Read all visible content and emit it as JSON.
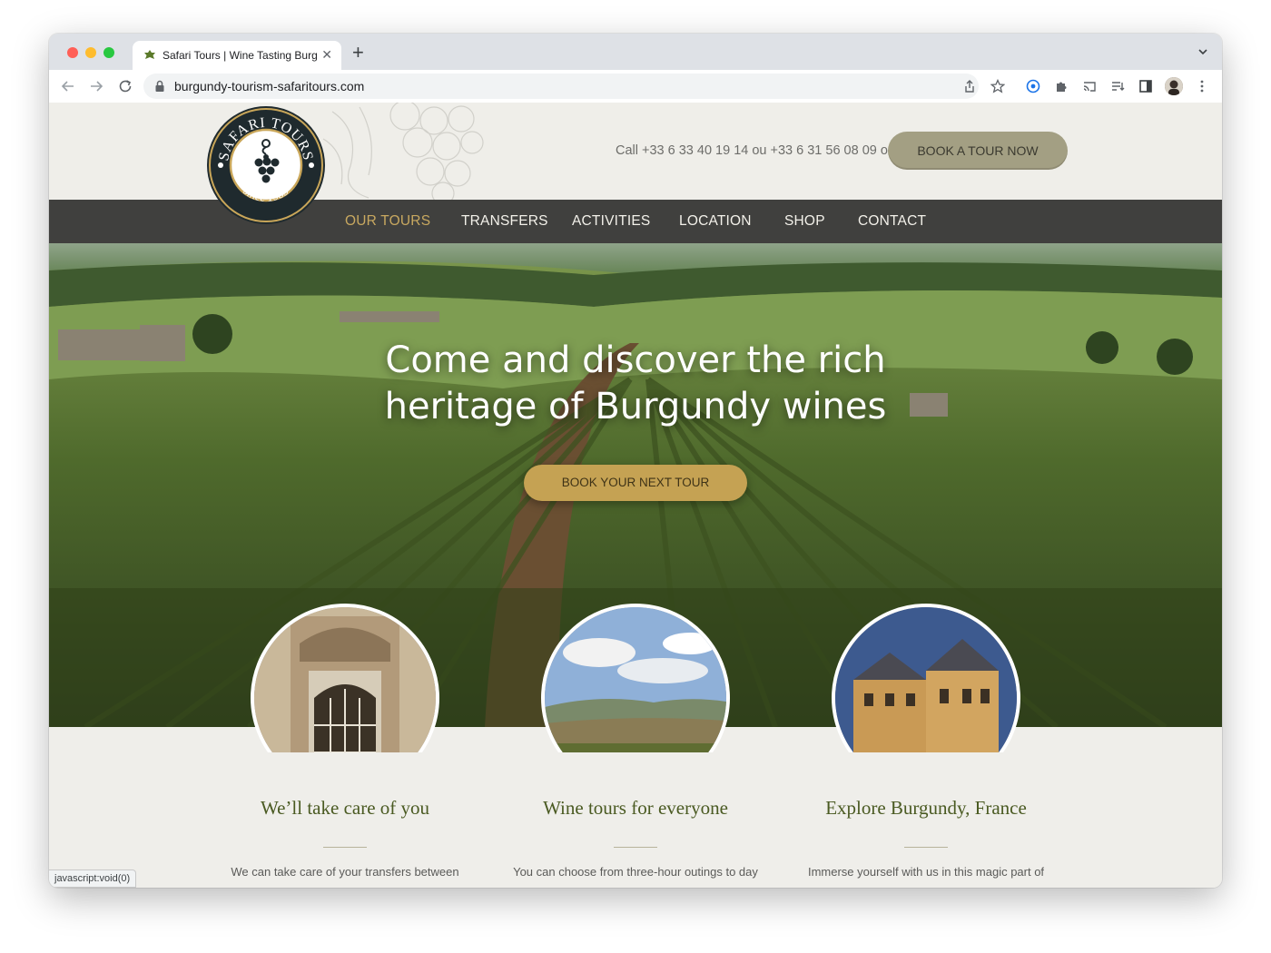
{
  "browser": {
    "tab_title": "Safari Tours | Wine Tasting Burg",
    "new_tab": "+",
    "tab_close": "✕",
    "url": "burgundy-tourism-safaritours.com",
    "status_text": "javascript:void(0)"
  },
  "header": {
    "call_text": "Call +33 6 33 40 19 14 ou +33 6 31 56 08 09 or",
    "book_now": "BOOK A TOUR NOW",
    "logo_top": "SAFARI TOURS",
    "logo_bottom": "since 1985"
  },
  "nav": {
    "items": [
      {
        "label": "OUR TOURS",
        "active": true
      },
      {
        "label": "TRANSFERS",
        "active": false
      },
      {
        "label": "ACTIVITIES",
        "active": false
      },
      {
        "label": "LOCATION",
        "active": false
      },
      {
        "label": "SHOP",
        "active": false
      },
      {
        "label": "CONTACT",
        "active": false
      }
    ]
  },
  "hero": {
    "title_line1": "Come and discover the rich",
    "title_line2": "heritage of Burgundy wines",
    "button": "BOOK YOUR NEXT TOUR"
  },
  "features": [
    {
      "title": "We’ll take care of you",
      "text": "We can take care of your transfers between",
      "image": "ornate-doorway-photo"
    },
    {
      "title": "Wine tours for everyone",
      "text": "You can choose from three-hour outings to day",
      "image": "vineyard-landscape-photo"
    },
    {
      "title": "Explore Burgundy, France",
      "text": "Immerse yourself with us in this magic part of",
      "image": "chateau-photo"
    }
  ],
  "colors": {
    "nav_active": "#c8a860",
    "accent_gold": "#c5a253",
    "book_button": "#a39f83",
    "feature_title": "#4a5a22"
  }
}
